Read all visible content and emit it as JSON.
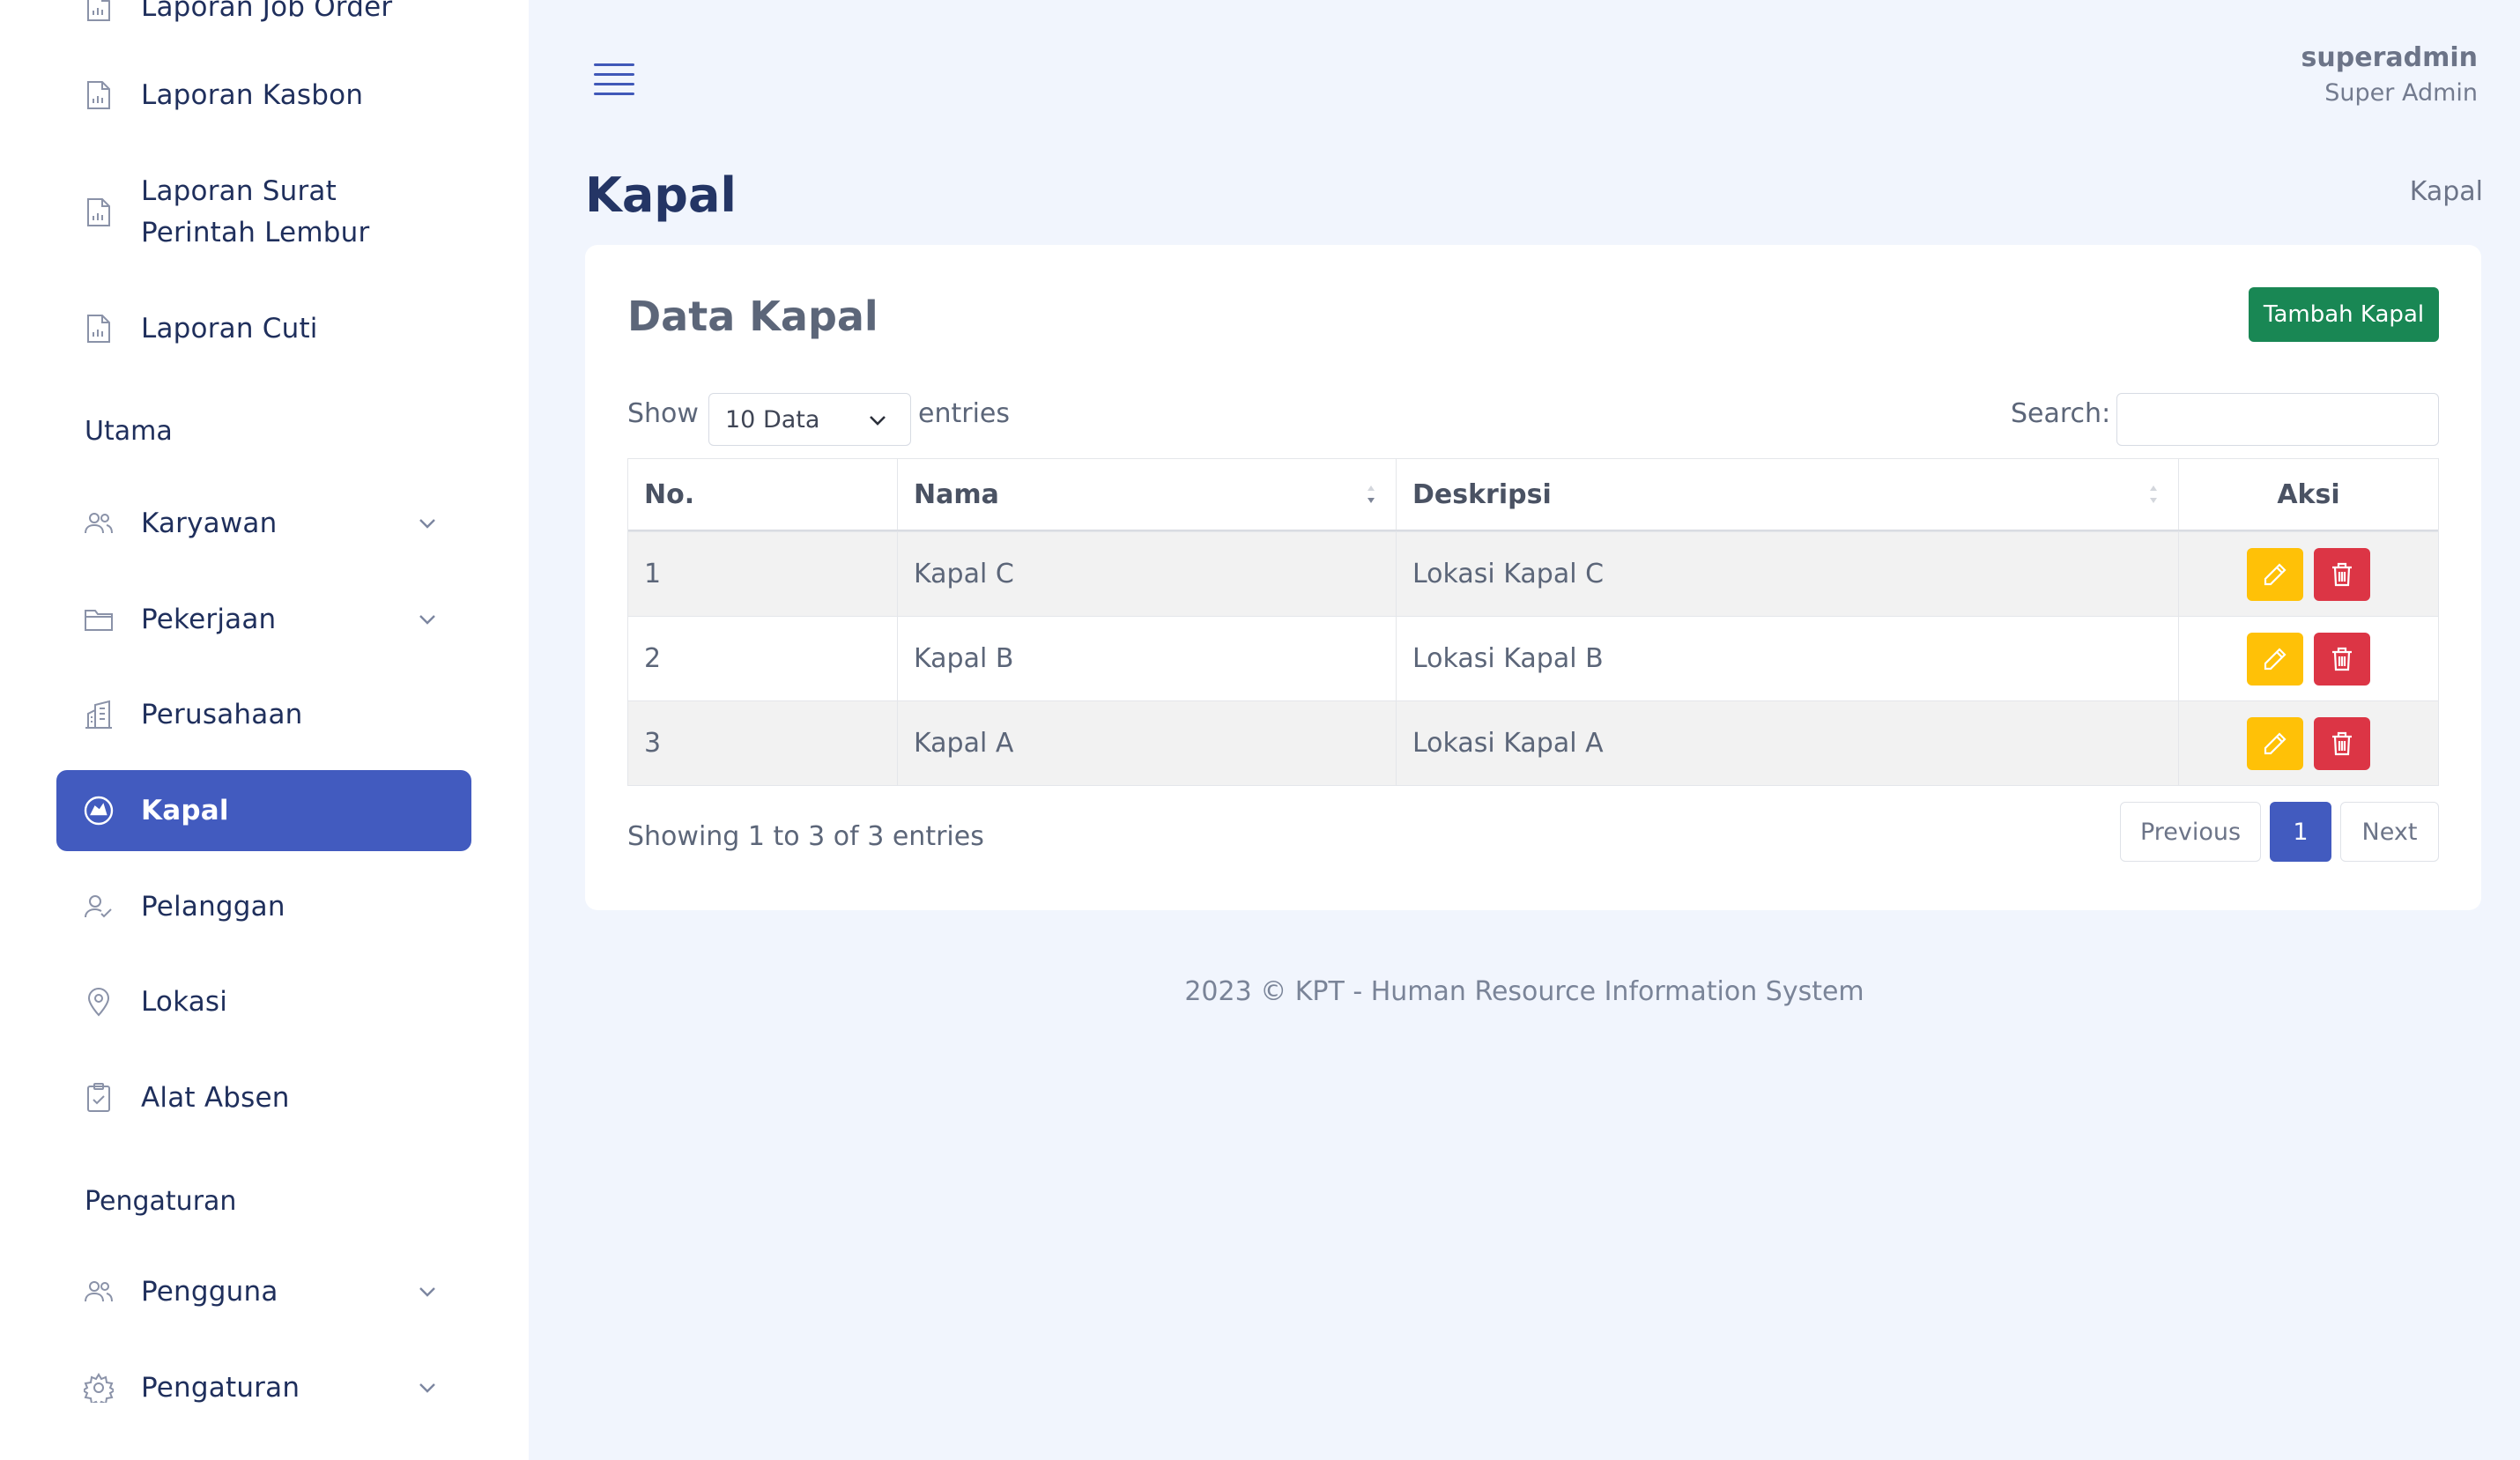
{
  "sidebar": {
    "items_top": [
      {
        "label": "Laporan Job Order",
        "icon": "report-icon"
      },
      {
        "label": "Laporan Kasbon",
        "icon": "report-icon"
      },
      {
        "label": "Laporan Surat Perintah Lembur",
        "icon": "report-icon"
      },
      {
        "label": "Laporan Cuti",
        "icon": "report-icon"
      }
    ],
    "section_utama": "Utama",
    "items_utama": [
      {
        "label": "Karyawan",
        "icon": "users-icon",
        "expandable": true
      },
      {
        "label": "Pekerjaan",
        "icon": "folder-icon",
        "expandable": true
      },
      {
        "label": "Perusahaan",
        "icon": "building-icon"
      },
      {
        "label": "Kapal",
        "icon": "ship-icon",
        "active": true
      },
      {
        "label": "Pelanggan",
        "icon": "customer-icon"
      },
      {
        "label": "Lokasi",
        "icon": "location-pin-icon"
      },
      {
        "label": "Alat Absen",
        "icon": "clipboard-check-icon"
      }
    ],
    "section_pengaturan": "Pengaturan",
    "items_pengaturan": [
      {
        "label": "Pengguna",
        "icon": "users-icon",
        "expandable": true
      },
      {
        "label": "Pengaturan",
        "icon": "gear-icon",
        "expandable": true
      }
    ]
  },
  "header": {
    "user_name": "superadmin",
    "user_role": "Super Admin"
  },
  "page": {
    "title": "Kapal",
    "breadcrumb": "Kapal"
  },
  "card": {
    "title": "Data Kapal",
    "add_button": "Tambah Kapal",
    "show_label": "Show",
    "page_size": "10 Data",
    "entries_label": "entries",
    "search_label": "Search:",
    "search_value": ""
  },
  "table": {
    "columns": [
      "No.",
      "Nama",
      "Deskripsi",
      "Aksi"
    ],
    "rows": [
      {
        "no": "1",
        "nama": "Kapal C",
        "deskripsi": "Lokasi Kapal C"
      },
      {
        "no": "2",
        "nama": "Kapal B",
        "deskripsi": "Lokasi Kapal B"
      },
      {
        "no": "3",
        "nama": "Kapal A",
        "deskripsi": "Lokasi Kapal A"
      }
    ],
    "info": "Showing 1 to 3 of 3 entries"
  },
  "pagination": {
    "previous": "Previous",
    "current": "1",
    "next": "Next"
  },
  "footer": "2023 © KPT - Human Resource Information System",
  "colors": {
    "accent": "#425bbf",
    "add_button": "#198754",
    "edit_button": "#ffc107",
    "delete_button": "#dc3545",
    "background": "#f1f5fd"
  }
}
